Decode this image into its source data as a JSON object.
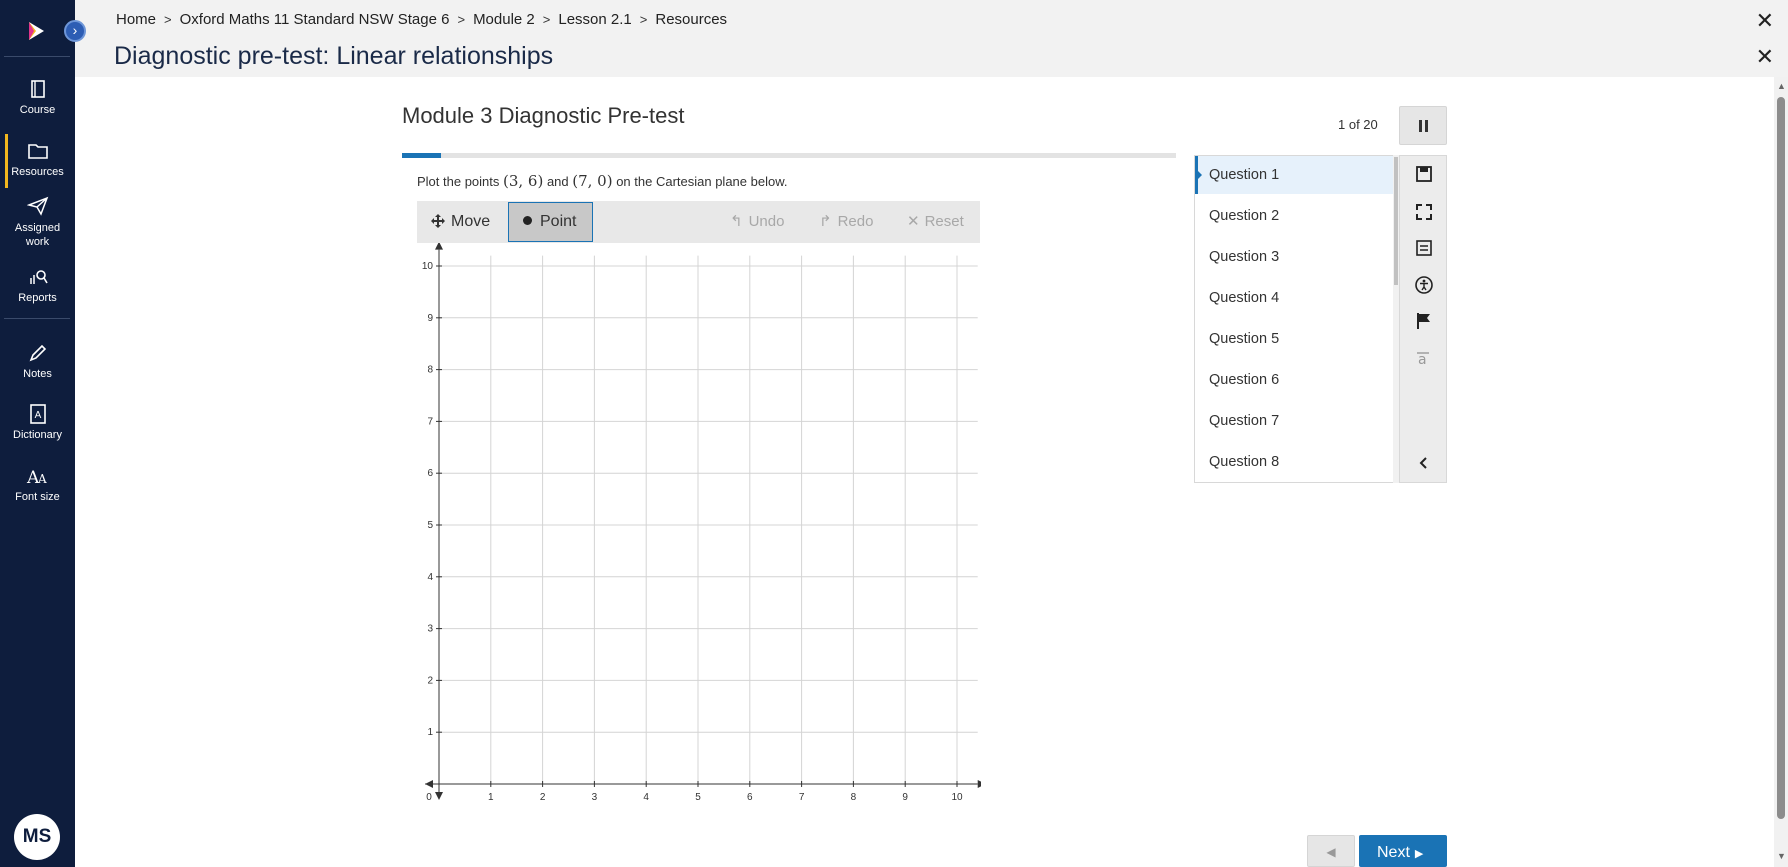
{
  "sidebar": {
    "items": [
      {
        "label": "Course"
      },
      {
        "label": "Resources"
      },
      {
        "label": "Assigned work"
      },
      {
        "label": "Reports"
      },
      {
        "label": "Notes"
      },
      {
        "label": "Dictionary"
      },
      {
        "label": "Font size"
      }
    ],
    "active_item": "Resources",
    "avatar_initials": "MS",
    "expand_glyph": "›"
  },
  "header": {
    "breadcrumb": [
      "Home",
      "Oxford Maths 11 Standard NSW Stage 6",
      "Module 2",
      "Lesson 2.1",
      "Resources"
    ],
    "title": "Diagnostic pre-test: Linear relationships",
    "close_glyph": "✕"
  },
  "quiz": {
    "title": "Module 3 Diagnostic Pre-test",
    "counter": "1 of 20",
    "progress": 0.05,
    "prompt": {
      "before": "Plot the points ",
      "point1": "(3, 6)",
      "middle": " and ",
      "point2": "(7, 0)",
      "after": " on the Cartesian plane below."
    }
  },
  "graph_toolbar": {
    "move_label": "Move",
    "point_label": "Point",
    "undo_label": "Undo",
    "redo_label": "Redo",
    "reset_label": "Reset",
    "selected_tool": "Point"
  },
  "chart_data": {
    "type": "scatter",
    "x_ticks": [
      "0",
      "1",
      "2",
      "3",
      "4",
      "5",
      "6",
      "7",
      "8",
      "9",
      "10"
    ],
    "y_ticks": [
      "1",
      "2",
      "3",
      "4",
      "5",
      "6",
      "7",
      "8",
      "9",
      "10"
    ],
    "xlim": [
      0,
      10.4
    ],
    "ylim": [
      0,
      10.2
    ],
    "grid": true,
    "points": []
  },
  "questions": [
    "Question 1",
    "Question 2",
    "Question 3",
    "Question 4",
    "Question 5",
    "Question 6",
    "Question 7",
    "Question 8"
  ],
  "active_question": 0,
  "rail_icons": [
    "save-icon",
    "fullscreen-icon",
    "list-icon",
    "accessibility-icon",
    "flag-icon",
    "translate-icon",
    "collapse-chevron-icon"
  ],
  "navigation": {
    "next_label": "Next",
    "prev_glyph": "◀"
  },
  "colors": {
    "sidebar_bg": "#0e1d3d",
    "accent": "#1a73b5",
    "active_marker": "#f2b71f"
  }
}
